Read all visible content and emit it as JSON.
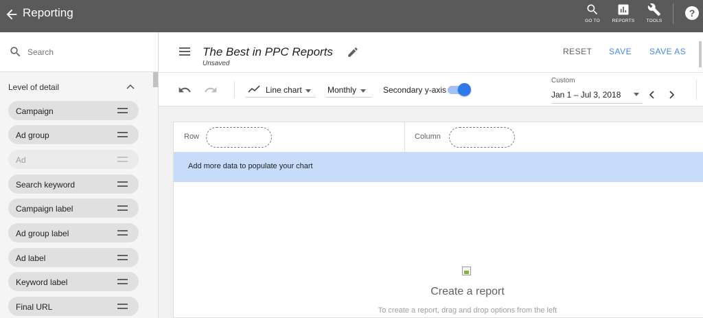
{
  "topbar": {
    "title": "Reporting",
    "goto_label": "GO TO",
    "reports_label": "REPORTS",
    "tools_label": "TOOLS",
    "help_glyph": "?",
    "background": "#5a5a5a"
  },
  "sidebar": {
    "search_placeholder": "Search",
    "section_title": "Level of detail",
    "items": [
      {
        "label": "Campaign",
        "enabled": true
      },
      {
        "label": "Ad group",
        "enabled": true
      },
      {
        "label": "Ad",
        "enabled": false
      },
      {
        "label": "Search keyword",
        "enabled": true
      },
      {
        "label": "Campaign label",
        "enabled": true
      },
      {
        "label": "Ad group label",
        "enabled": true
      },
      {
        "label": "Ad label",
        "enabled": true
      },
      {
        "label": "Keyword label",
        "enabled": true
      },
      {
        "label": "Final URL",
        "enabled": true
      }
    ]
  },
  "header": {
    "report_title": "The Best in PPC Reports",
    "status": "Unsaved",
    "reset_label": "RESET",
    "save_label": "SAVE",
    "save_as_label": "SAVE AS",
    "accent": "#4285f4"
  },
  "toolbar": {
    "chart_type": "Line chart",
    "granularity": "Monthly",
    "secondary_axis_label": "Secondary y-axis",
    "secondary_axis_on": true,
    "date_preset": "Custom",
    "date_range": "Jan 1 – Jul 3, 2018"
  },
  "canvas": {
    "row_label": "Row",
    "column_label": "Column",
    "banner_text": "Add more data to populate your chart",
    "banner_color": "#c6dcfa",
    "empty_title": "Create a report",
    "empty_subtitle": "To create a report, drag and drop options from the left"
  }
}
